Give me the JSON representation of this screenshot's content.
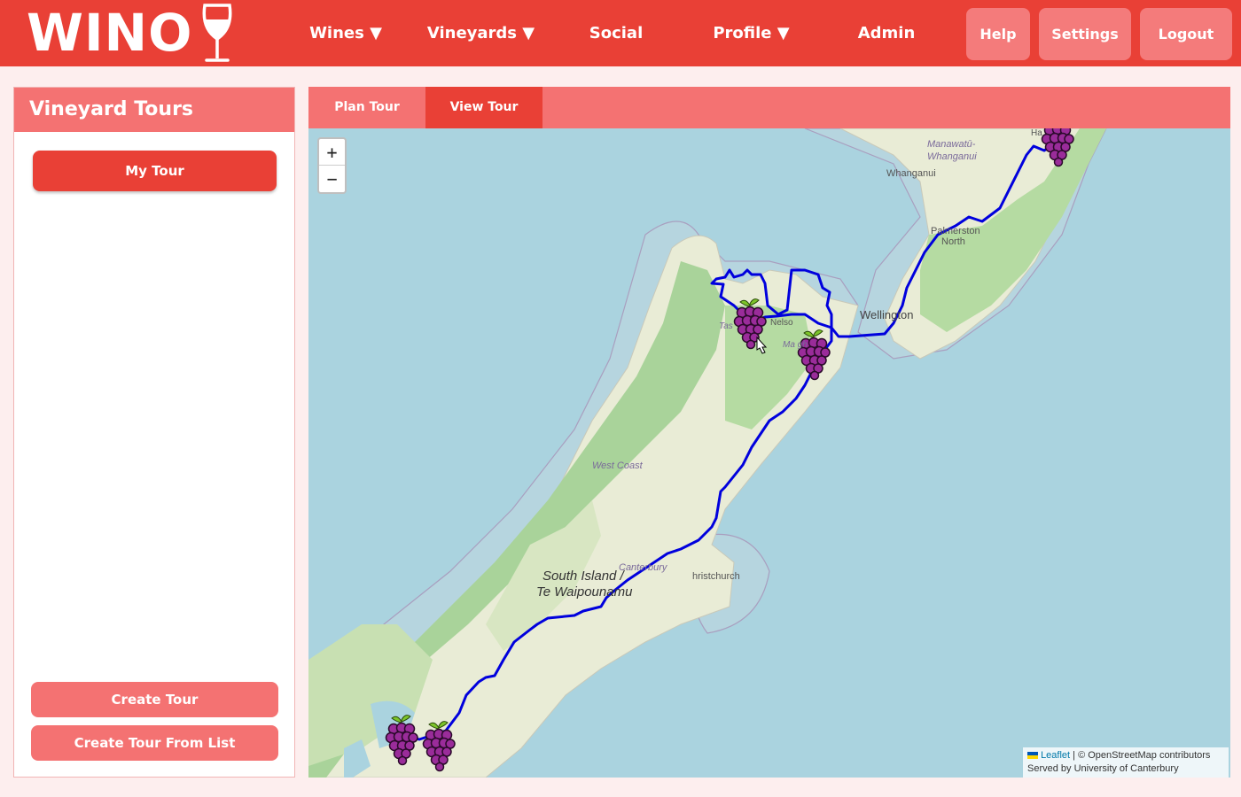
{
  "app": {
    "logo_text": "WINO",
    "logo_icon": "wine-glass-icon"
  },
  "nav": {
    "items": [
      "Wines ▼",
      "Vineyards ▼",
      "Social",
      "Profile ▼",
      "Admin"
    ],
    "buttons": [
      "Help",
      "Settings",
      "Logout"
    ]
  },
  "sidebar": {
    "title": "Vineyard Tours",
    "tours": [
      "My Tour"
    ],
    "create_tour": "Create Tour",
    "create_tour_from_list": "Create Tour From List"
  },
  "tabs": {
    "plan": "Plan Tour",
    "view": "View Tour",
    "active": "View Tour"
  },
  "map": {
    "zoom_in": "+",
    "zoom_out": "−",
    "labels": {
      "manawatu": "Manawatū-",
      "whanganui_region": "Whanganui",
      "whanganui": "Whanganui",
      "palmerston": "Palmerston",
      "north": "North",
      "wellington": "Wellington",
      "nelson": "Nelso",
      "tasman": "Tas",
      "marlborough": "Ma       gh",
      "west_coast": "West Coast",
      "canterbury": "Canterbury",
      "christchurch": "hristchurch",
      "south_island_1": "South Island /",
      "south_island_2": "Te Waipounamu",
      "hawkes": "Ha"
    },
    "marker_icon": "grapes-icon",
    "route_color": "#0000dd",
    "attribution_leaflet": "Leaflet",
    "attribution_rest": "| © OpenStreetMap contributors",
    "attribution_served": "Served by University of Canterbury"
  },
  "colors": {
    "primary": "#e94036",
    "secondary": "#f47272",
    "background": "#fdeeee"
  }
}
